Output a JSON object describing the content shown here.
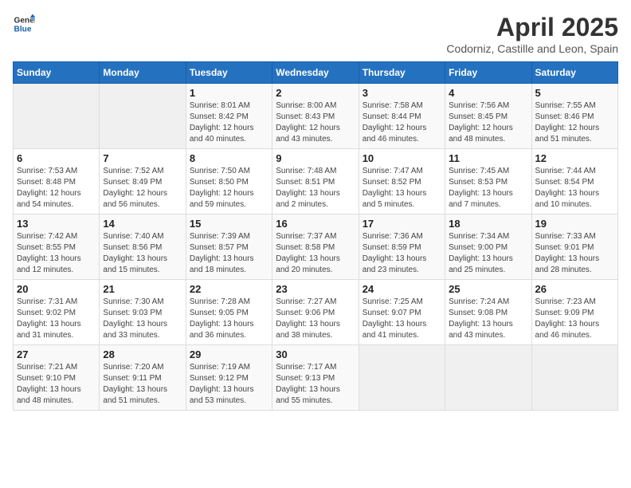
{
  "logo": {
    "general": "General",
    "blue": "Blue"
  },
  "header": {
    "title": "April 2025",
    "subtitle": "Codorniz, Castille and Leon, Spain"
  },
  "weekdays": [
    "Sunday",
    "Monday",
    "Tuesday",
    "Wednesday",
    "Thursday",
    "Friday",
    "Saturday"
  ],
  "weeks": [
    [
      {
        "day": "",
        "sunrise": "",
        "sunset": "",
        "daylight": ""
      },
      {
        "day": "",
        "sunrise": "",
        "sunset": "",
        "daylight": ""
      },
      {
        "day": "1",
        "sunrise": "Sunrise: 8:01 AM",
        "sunset": "Sunset: 8:42 PM",
        "daylight": "Daylight: 12 hours and 40 minutes."
      },
      {
        "day": "2",
        "sunrise": "Sunrise: 8:00 AM",
        "sunset": "Sunset: 8:43 PM",
        "daylight": "Daylight: 12 hours and 43 minutes."
      },
      {
        "day": "3",
        "sunrise": "Sunrise: 7:58 AM",
        "sunset": "Sunset: 8:44 PM",
        "daylight": "Daylight: 12 hours and 46 minutes."
      },
      {
        "day": "4",
        "sunrise": "Sunrise: 7:56 AM",
        "sunset": "Sunset: 8:45 PM",
        "daylight": "Daylight: 12 hours and 48 minutes."
      },
      {
        "day": "5",
        "sunrise": "Sunrise: 7:55 AM",
        "sunset": "Sunset: 8:46 PM",
        "daylight": "Daylight: 12 hours and 51 minutes."
      }
    ],
    [
      {
        "day": "6",
        "sunrise": "Sunrise: 7:53 AM",
        "sunset": "Sunset: 8:48 PM",
        "daylight": "Daylight: 12 hours and 54 minutes."
      },
      {
        "day": "7",
        "sunrise": "Sunrise: 7:52 AM",
        "sunset": "Sunset: 8:49 PM",
        "daylight": "Daylight: 12 hours and 56 minutes."
      },
      {
        "day": "8",
        "sunrise": "Sunrise: 7:50 AM",
        "sunset": "Sunset: 8:50 PM",
        "daylight": "Daylight: 12 hours and 59 minutes."
      },
      {
        "day": "9",
        "sunrise": "Sunrise: 7:48 AM",
        "sunset": "Sunset: 8:51 PM",
        "daylight": "Daylight: 13 hours and 2 minutes."
      },
      {
        "day": "10",
        "sunrise": "Sunrise: 7:47 AM",
        "sunset": "Sunset: 8:52 PM",
        "daylight": "Daylight: 13 hours and 5 minutes."
      },
      {
        "day": "11",
        "sunrise": "Sunrise: 7:45 AM",
        "sunset": "Sunset: 8:53 PM",
        "daylight": "Daylight: 13 hours and 7 minutes."
      },
      {
        "day": "12",
        "sunrise": "Sunrise: 7:44 AM",
        "sunset": "Sunset: 8:54 PM",
        "daylight": "Daylight: 13 hours and 10 minutes."
      }
    ],
    [
      {
        "day": "13",
        "sunrise": "Sunrise: 7:42 AM",
        "sunset": "Sunset: 8:55 PM",
        "daylight": "Daylight: 13 hours and 12 minutes."
      },
      {
        "day": "14",
        "sunrise": "Sunrise: 7:40 AM",
        "sunset": "Sunset: 8:56 PM",
        "daylight": "Daylight: 13 hours and 15 minutes."
      },
      {
        "day": "15",
        "sunrise": "Sunrise: 7:39 AM",
        "sunset": "Sunset: 8:57 PM",
        "daylight": "Daylight: 13 hours and 18 minutes."
      },
      {
        "day": "16",
        "sunrise": "Sunrise: 7:37 AM",
        "sunset": "Sunset: 8:58 PM",
        "daylight": "Daylight: 13 hours and 20 minutes."
      },
      {
        "day": "17",
        "sunrise": "Sunrise: 7:36 AM",
        "sunset": "Sunset: 8:59 PM",
        "daylight": "Daylight: 13 hours and 23 minutes."
      },
      {
        "day": "18",
        "sunrise": "Sunrise: 7:34 AM",
        "sunset": "Sunset: 9:00 PM",
        "daylight": "Daylight: 13 hours and 25 minutes."
      },
      {
        "day": "19",
        "sunrise": "Sunrise: 7:33 AM",
        "sunset": "Sunset: 9:01 PM",
        "daylight": "Daylight: 13 hours and 28 minutes."
      }
    ],
    [
      {
        "day": "20",
        "sunrise": "Sunrise: 7:31 AM",
        "sunset": "Sunset: 9:02 PM",
        "daylight": "Daylight: 13 hours and 31 minutes."
      },
      {
        "day": "21",
        "sunrise": "Sunrise: 7:30 AM",
        "sunset": "Sunset: 9:03 PM",
        "daylight": "Daylight: 13 hours and 33 minutes."
      },
      {
        "day": "22",
        "sunrise": "Sunrise: 7:28 AM",
        "sunset": "Sunset: 9:05 PM",
        "daylight": "Daylight: 13 hours and 36 minutes."
      },
      {
        "day": "23",
        "sunrise": "Sunrise: 7:27 AM",
        "sunset": "Sunset: 9:06 PM",
        "daylight": "Daylight: 13 hours and 38 minutes."
      },
      {
        "day": "24",
        "sunrise": "Sunrise: 7:25 AM",
        "sunset": "Sunset: 9:07 PM",
        "daylight": "Daylight: 13 hours and 41 minutes."
      },
      {
        "day": "25",
        "sunrise": "Sunrise: 7:24 AM",
        "sunset": "Sunset: 9:08 PM",
        "daylight": "Daylight: 13 hours and 43 minutes."
      },
      {
        "day": "26",
        "sunrise": "Sunrise: 7:23 AM",
        "sunset": "Sunset: 9:09 PM",
        "daylight": "Daylight: 13 hours and 46 minutes."
      }
    ],
    [
      {
        "day": "27",
        "sunrise": "Sunrise: 7:21 AM",
        "sunset": "Sunset: 9:10 PM",
        "daylight": "Daylight: 13 hours and 48 minutes."
      },
      {
        "day": "28",
        "sunrise": "Sunrise: 7:20 AM",
        "sunset": "Sunset: 9:11 PM",
        "daylight": "Daylight: 13 hours and 51 minutes."
      },
      {
        "day": "29",
        "sunrise": "Sunrise: 7:19 AM",
        "sunset": "Sunset: 9:12 PM",
        "daylight": "Daylight: 13 hours and 53 minutes."
      },
      {
        "day": "30",
        "sunrise": "Sunrise: 7:17 AM",
        "sunset": "Sunset: 9:13 PM",
        "daylight": "Daylight: 13 hours and 55 minutes."
      },
      {
        "day": "",
        "sunrise": "",
        "sunset": "",
        "daylight": ""
      },
      {
        "day": "",
        "sunrise": "",
        "sunset": "",
        "daylight": ""
      },
      {
        "day": "",
        "sunrise": "",
        "sunset": "",
        "daylight": ""
      }
    ]
  ]
}
